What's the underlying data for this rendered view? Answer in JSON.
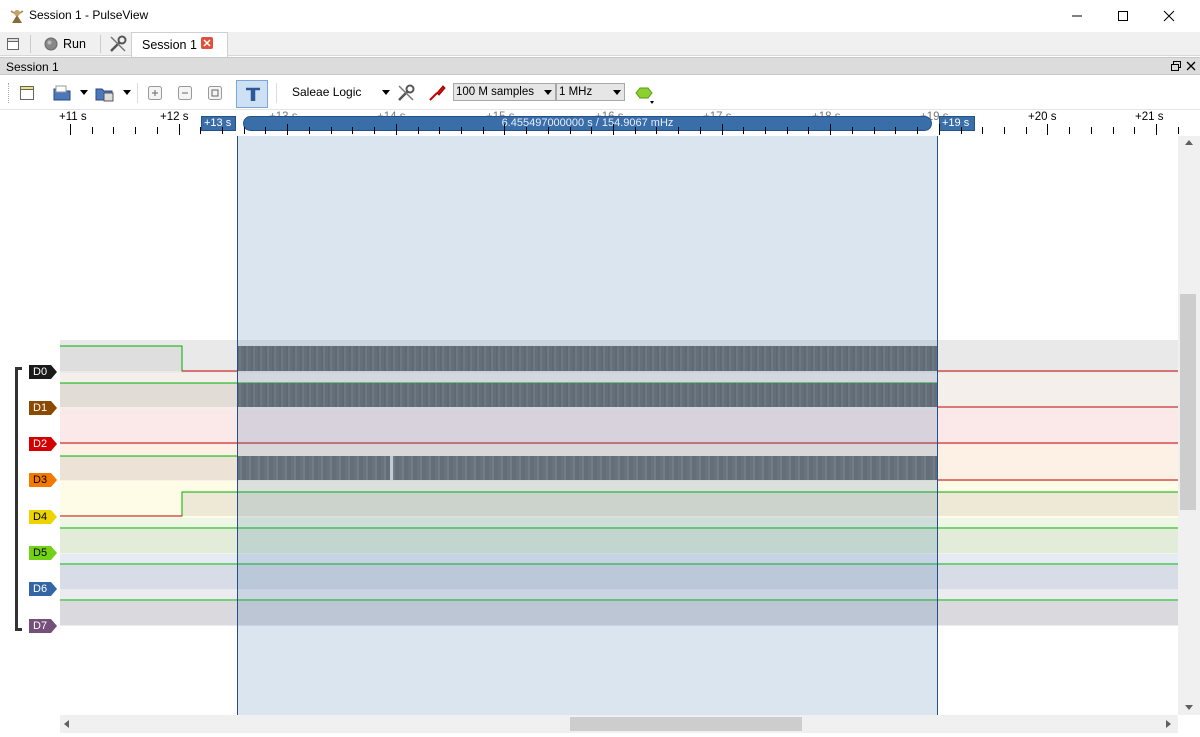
{
  "window": {
    "title": "Session 1 - PulseView",
    "minimize_glyph": "—",
    "maximize_glyph": "☐",
    "close_glyph": "✕"
  },
  "tabs": {
    "run_label": "Run",
    "session_tab_label": "Session 1"
  },
  "dock": {
    "title": "Session 1"
  },
  "toolbar": {
    "device": "Saleae Logic",
    "sample_count": "100 M samples",
    "sample_rate": "1 MHz"
  },
  "ruler": {
    "tick_labels": [
      "+11 s",
      "+12 s",
      "+13 s",
      "+14 s",
      "+15 s",
      "+16 s",
      "+17 s",
      "+18 s",
      "+19 s",
      "+20 s",
      "+21 s"
    ],
    "cursor_start_label": "+13 s",
    "cursor_end_label": "+19 s",
    "cursor_measurement": "6.455497000000 s / 154.9067 mHz"
  },
  "signals": [
    {
      "name": "D0",
      "color": "#1a1a1a"
    },
    {
      "name": "D1",
      "color": "#8b4a00"
    },
    {
      "name": "D2",
      "color": "#d40000"
    },
    {
      "name": "D3",
      "color": "#f57900"
    },
    {
      "name": "D4",
      "color": "#edd400"
    },
    {
      "name": "D5",
      "color": "#73d216"
    },
    {
      "name": "D6",
      "color": "#3465a4"
    },
    {
      "name": "D7",
      "color": "#75507b"
    }
  ],
  "colors": {
    "accent": "#3a6ea8",
    "high_trace": "#00b000",
    "low_trace": "#c00000"
  }
}
